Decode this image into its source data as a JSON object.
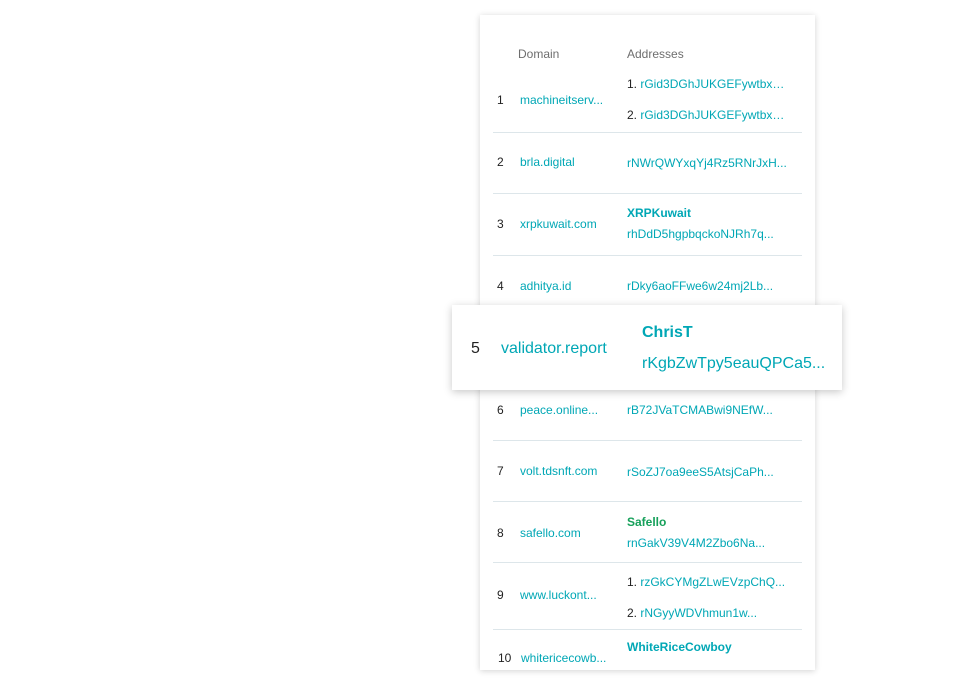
{
  "table": {
    "headers": {
      "domain": "Domain",
      "addresses": "Addresses"
    },
    "rows": [
      {
        "num": "1",
        "domain": "machineitserv...",
        "name": "",
        "addresses": [
          "rGid3DGhJUKGEFywtbx8...",
          "rGid3DGhJUKGEFywtbx8..."
        ]
      },
      {
        "num": "2",
        "domain": "brla.digital",
        "name": "",
        "addresses": [
          "rNWrQWYxqYj4Rz5RNrJxH..."
        ]
      },
      {
        "num": "3",
        "domain": "xrpkuwait.com",
        "name": "XRPKuwait",
        "addresses": [
          "rhDdD5hgpbqckoNJRh7q..."
        ]
      },
      {
        "num": "4",
        "domain": "adhitya.id",
        "name": "",
        "addresses": [
          "rDky6aoFFwe6w24mj2Lb..."
        ]
      },
      {
        "num": "5",
        "domain": "validator.report",
        "name": "ChrisT",
        "addresses": [
          "rKgbZwTpy5eauQPCa5..."
        ]
      },
      {
        "num": "6",
        "domain": "peace.online...",
        "name": "",
        "addresses": [
          "rB72JVaTCMABwi9NEfW..."
        ]
      },
      {
        "num": "7",
        "domain": "volt.tdsnft.com",
        "name": "",
        "addresses": [
          "rSoZJ7oa9eeS5AtsjCaPh..."
        ]
      },
      {
        "num": "8",
        "domain": "safello.com",
        "name": "Safello",
        "addresses": [
          "rnGakV39V4M2Zbo6Na..."
        ]
      },
      {
        "num": "9",
        "domain": "www.luckont...",
        "name": "",
        "addresses": [
          "rzGkCYMgZLwEVzpChQ...",
          "rNGyyWDVhmun1w..."
        ]
      },
      {
        "num": "10",
        "domain": "whitericecowb...",
        "name": "WhiteRiceCowboy",
        "addresses": []
      }
    ]
  },
  "colors": {
    "link": "#00a7b5",
    "verified": "#16a05a",
    "text": "#222222",
    "divider": "#dde6ea"
  }
}
